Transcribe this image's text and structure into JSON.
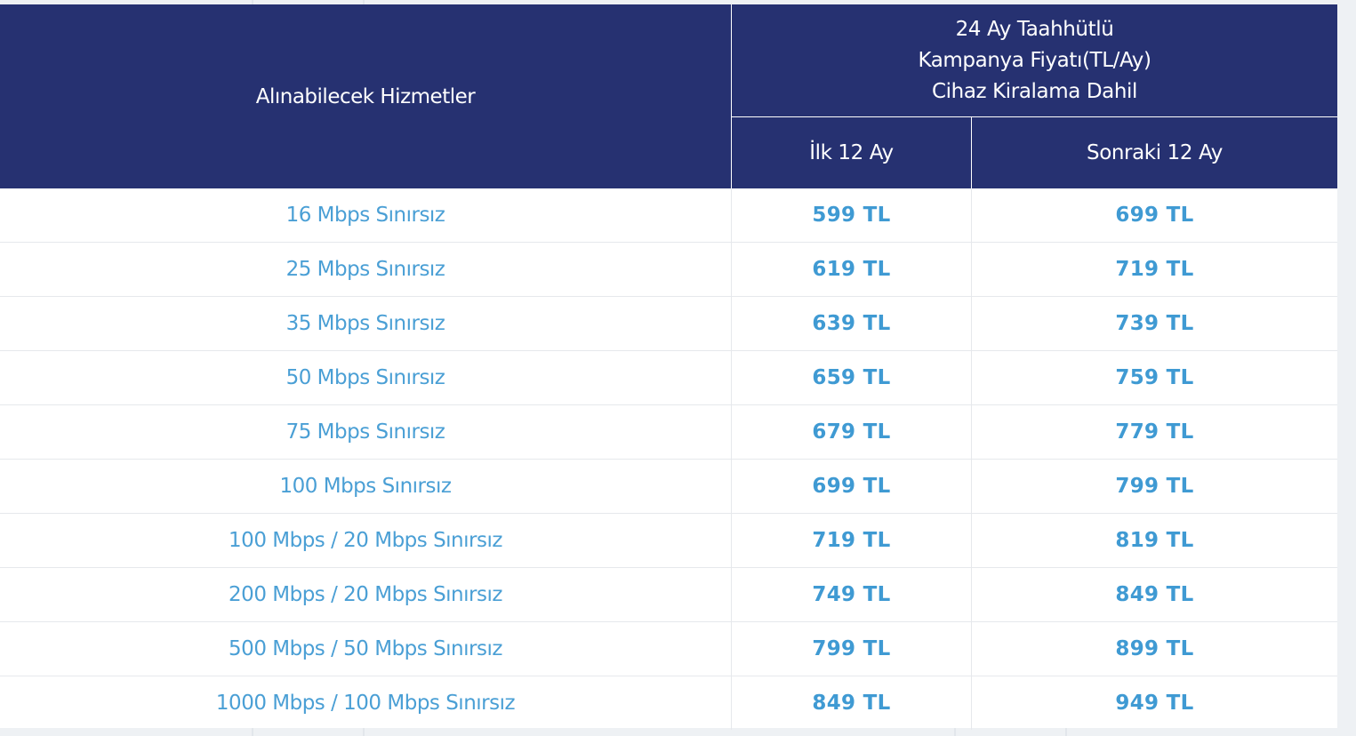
{
  "table": {
    "header": {
      "services_label": "Alınabilecek Hizmetler",
      "campaign_lines": [
        "24 Ay Taahhütlü",
        "Kampanya Fiyatı(TL/Ay)",
        "Cihaz Kiralama Dahil"
      ],
      "first_period_label": "İlk 12 Ay",
      "next_period_label": "Sonraki 12 Ay"
    },
    "rows": [
      {
        "service": "16 Mbps Sınırsız",
        "first": "599 TL",
        "next": "699 TL"
      },
      {
        "service": "25 Mbps Sınırsız",
        "first": "619 TL",
        "next": "719 TL"
      },
      {
        "service": "35 Mbps Sınırsız",
        "first": "639 TL",
        "next": "739 TL"
      },
      {
        "service": "50 Mbps Sınırsız",
        "first": "659 TL",
        "next": "759 TL"
      },
      {
        "service": "75 Mbps Sınırsız",
        "first": "679 TL",
        "next": "779 TL"
      },
      {
        "service": "100 Mbps Sınırsız",
        "first": "699 TL",
        "next": "799 TL"
      },
      {
        "service": "100 Mbps / 20 Mbps Sınırsız",
        "first": "719 TL",
        "next": "819 TL"
      },
      {
        "service": "200 Mbps / 20 Mbps Sınırsız",
        "first": "749 TL",
        "next": "849 TL"
      },
      {
        "service": "500 Mbps / 50 Mbps Sınırsız",
        "first": "799 TL",
        "next": "899 TL"
      },
      {
        "service": "1000 Mbps / 100 Mbps Sınırsız",
        "first": "849 TL",
        "next": "949 TL"
      }
    ]
  },
  "colors": {
    "header_bg": "#263171",
    "header_text": "#ffffff",
    "body_text": "#4a9fd5",
    "row_border": "#e6e8ec"
  }
}
